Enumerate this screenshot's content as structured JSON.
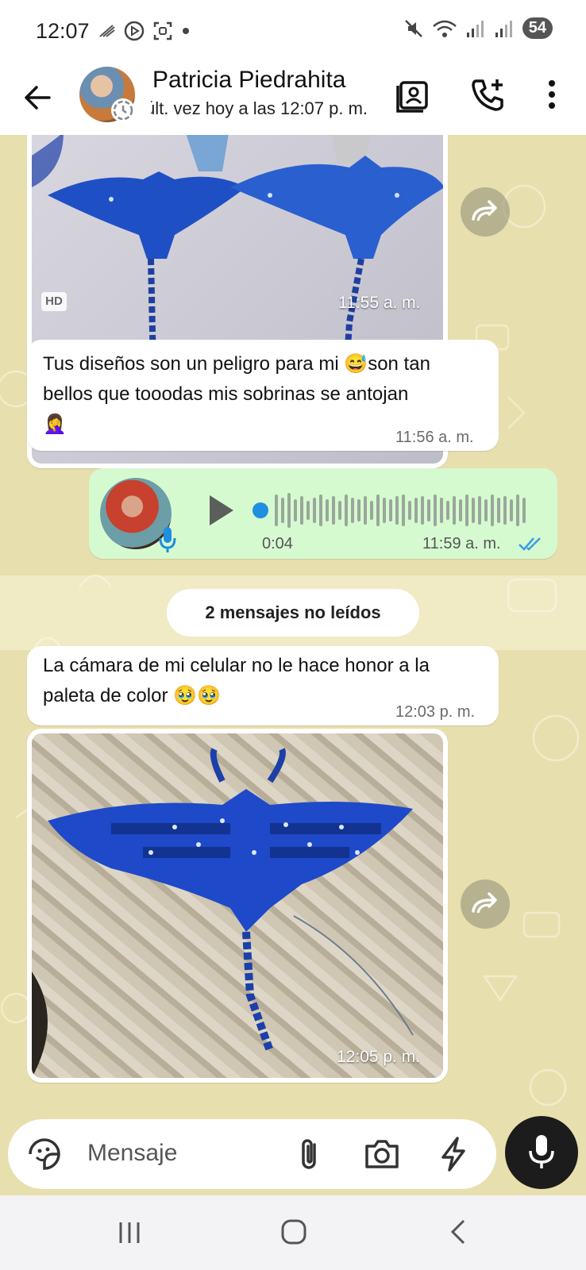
{
  "status_bar": {
    "time": "12:07",
    "battery": "54"
  },
  "header": {
    "contact_name": "Patricia Piedrahita",
    "status": "últ. vez hoy a las 12:07 p. m."
  },
  "messages": [
    {
      "type": "image",
      "badge": "HD",
      "time": "11:55 a. m."
    },
    {
      "type": "text",
      "line1": "Tus diseños son un peligro para mi 😅son tan",
      "line2": "bellos que tooodas mis sobrinas se antojan",
      "line3": "🤦‍♀️",
      "time": "11:56 a. m."
    },
    {
      "type": "audio",
      "duration": "0:04",
      "time": "11:59 a. m.",
      "status": "read"
    },
    {
      "type": "text",
      "line1": "La cámara de mi celular no le hace honor a la",
      "line2": "paleta de color 🥹🥹",
      "time": "12:03 p. m."
    },
    {
      "type": "image",
      "time": "12:05 p. m."
    }
  ],
  "unread_divider": "2 mensajes no leídos",
  "input": {
    "placeholder": "Mensaje"
  },
  "colors": {
    "chat_bg": "#e8dfae",
    "outgoing_bubble": "#d6fad0",
    "accent_blue": "#1f8fe0",
    "read_ticks": "#3b9de6"
  }
}
